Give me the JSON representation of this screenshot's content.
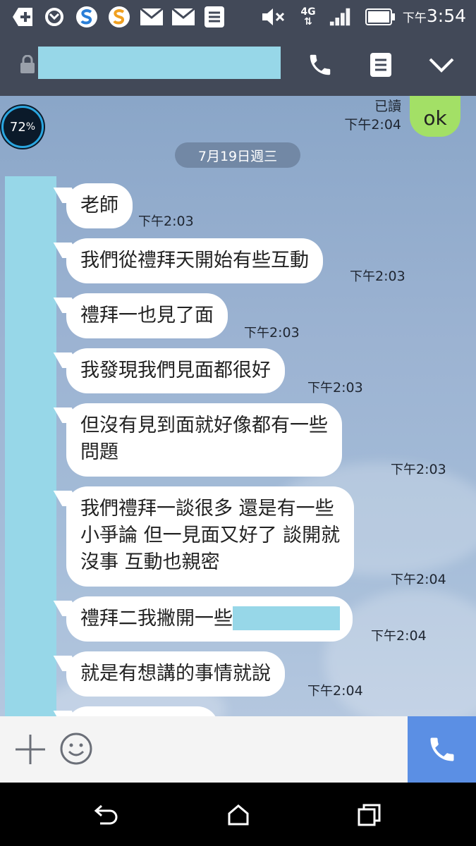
{
  "status_bar": {
    "time_prefix": "下午",
    "time": "3:54",
    "network": "4G"
  },
  "header": {
    "title_redacted": true
  },
  "chat": {
    "top_outgoing": {
      "text": "ok",
      "read_label": "已讀",
      "time_prefix": "下午",
      "time": "2:04"
    },
    "battery_badge": {
      "value": "72",
      "unit": "%"
    },
    "date_separator": "7月19日週三",
    "messages": [
      {
        "text": "老師",
        "time_prefix": "下午",
        "time": "2:03"
      },
      {
        "text": "我們從禮拜天開始有些互動",
        "time_prefix": "下午",
        "time": "2:03"
      },
      {
        "text": "禮拜一也見了面",
        "time_prefix": "下午",
        "time": "2:03"
      },
      {
        "text": "我發現我們見面都很好",
        "time_prefix": "下午",
        "time": "2:03"
      },
      {
        "line1": "但沒有見到面就好像都有一些",
        "line2": "問題",
        "time_prefix": "下午",
        "time": "2:03"
      },
      {
        "line1": "我們禮拜一談很多 還是有一些",
        "line2": "小爭論 但一見面又好了 談開就",
        "line3": "沒事 互動也親密",
        "time_prefix": "下午",
        "time": "2:04"
      },
      {
        "text": "禮拜二我撇開一些",
        "time_prefix": "下午",
        "time": "2:04"
      },
      {
        "text": "就是有想講的事情就說",
        "time_prefix": "下午",
        "time": "2:04"
      }
    ]
  },
  "colors": {
    "header_bg": "#424958",
    "outgoing_bubble": "#a3e066",
    "call_button": "#5b8fe4",
    "redaction": "#97d7e8"
  }
}
